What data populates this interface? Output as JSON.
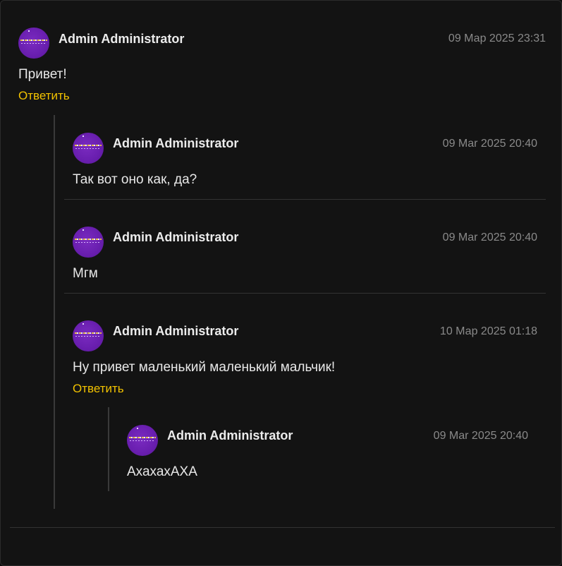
{
  "comments": [
    {
      "author": "Admin Administrator",
      "date": "09 Мар 2025 23:31",
      "text": "Привет!",
      "reply_label": "Ответить"
    },
    {
      "author": "Admin Administrator",
      "date": "09 Mar 2025 20:40",
      "text": "Так вот оно как, да?"
    },
    {
      "author": "Admin Administrator",
      "date": "09 Mar 2025 20:40",
      "text": "Мгм"
    },
    {
      "author": "Admin Administrator",
      "date": "10 Мар 2025 01:18",
      "text": "Ну привет маленький маленький мальчик!",
      "reply_label": "Ответить"
    },
    {
      "author": "Admin Administrator",
      "date": "09 Mar 2025 20:40",
      "text": "АхахахАХА"
    }
  ]
}
